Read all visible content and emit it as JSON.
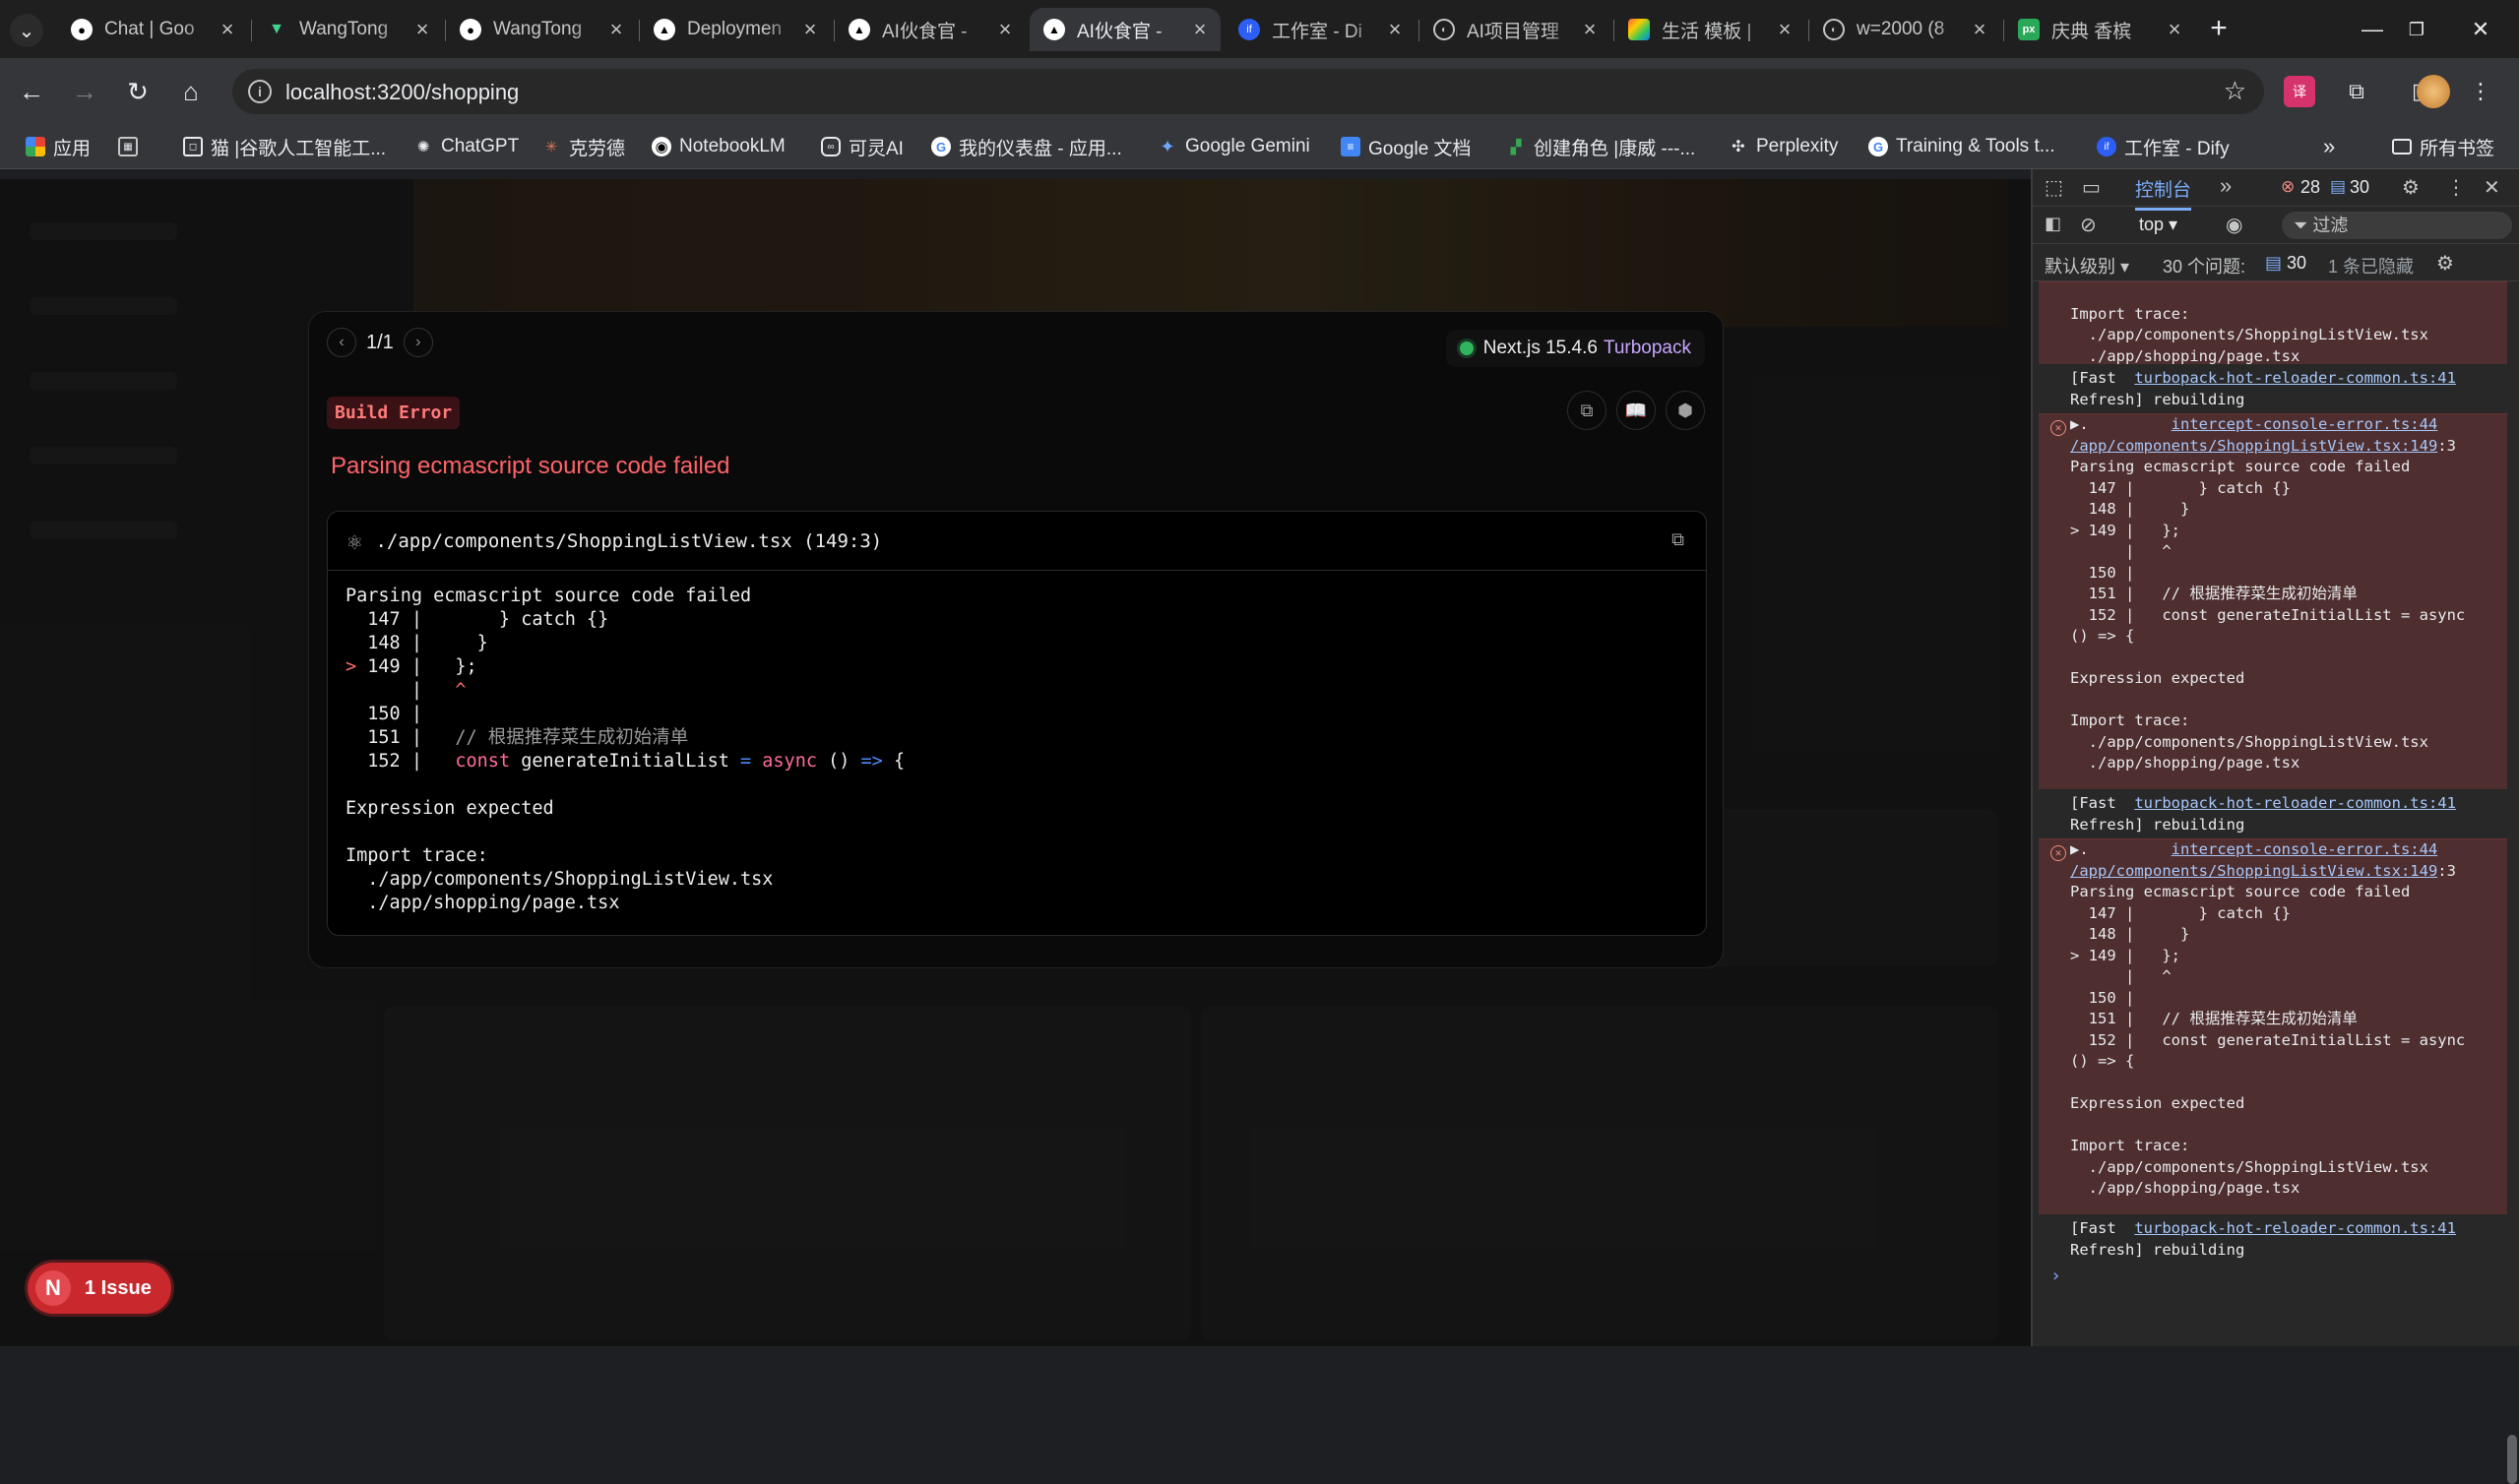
{
  "browser": {
    "tabs": [
      {
        "title": "Chat | Goo",
        "icon": "github-icon"
      },
      {
        "title": "WangTong",
        "icon": "vue-icon"
      },
      {
        "title": "WangTong",
        "icon": "github-icon"
      },
      {
        "title": "Deploymen",
        "icon": "vercel-icon"
      },
      {
        "title": "AI伙食官 - ",
        "icon": "vercel-icon"
      },
      {
        "title": "AI伙食官 - ",
        "icon": "vercel-icon",
        "active": true
      },
      {
        "title": "工作室 - Di",
        "icon": "dify-icon"
      },
      {
        "title": "AI项目管理",
        "icon": "globe-icon"
      },
      {
        "title": "生活 模板 |",
        "icon": "colorful-icon"
      },
      {
        "title": "w=2000 (8",
        "icon": "globe-icon"
      },
      {
        "title": "庆典 香槟",
        "icon": "px-icon"
      }
    ],
    "url": "localhost:3200/shopping",
    "bookmarks": [
      {
        "label": "应用",
        "icon": "apps-grid-icon"
      },
      {
        "label": "",
        "icon": "grid-icon"
      },
      {
        "label": "猫 |谷歌人工智能工...",
        "icon": "cat-icon"
      },
      {
        "label": "ChatGPT",
        "icon": "chatgpt-icon"
      },
      {
        "label": "克劳德",
        "icon": "claude-icon"
      },
      {
        "label": "NotebookLM",
        "icon": "notebooklm-icon"
      },
      {
        "label": "可灵AI",
        "icon": "kling-icon"
      },
      {
        "label": "我的仪表盘 - 应用...",
        "icon": "google-icon"
      },
      {
        "label": "Google Gemini",
        "icon": "gemini-icon"
      },
      {
        "label": "Google 文档",
        "icon": "docs-icon"
      },
      {
        "label": "创建角色 |康威 ---...",
        "icon": "conway-icon"
      },
      {
        "label": "Perplexity",
        "icon": "perplexity-icon"
      },
      {
        "label": "Training & Tools t...",
        "icon": "google-icon"
      },
      {
        "label": "工作室 - Dify",
        "icon": "dify-icon"
      }
    ],
    "all_bookmarks": "所有书签"
  },
  "overlay": {
    "pager": "1/1",
    "next_version": "Next.js 15.4.6",
    "bundler": "Turbopack",
    "badge": "Build Error",
    "title": "Parsing ecmascript source code failed",
    "file": "./app/components/ShoppingListView.tsx (149:3)",
    "code": {
      "heading": "Parsing ecmascript source code failed",
      "expected": "Expression expected",
      "import_trace_label": "Import trace:",
      "trace": [
        "./app/components/ShoppingListView.tsx",
        "./app/shopping/page.tsx"
      ]
    }
  },
  "issue_pill": {
    "letter": "N",
    "label": "1 Issue"
  },
  "devtools": {
    "console_tab": "控制台",
    "errors_count": "28",
    "messages_count": "30",
    "context": "top",
    "filter_placeholder": "过滤",
    "level": "默认级别",
    "issues": "30 个问题:",
    "issues_count": "30",
    "hidden": "1 条已隐藏",
    "reloader_link": "turbopack-hot-reloader-common.ts:41",
    "console_error_link": "intercept-console-error.ts:44",
    "source_link": "/app/components/ShoppingListView.tsx:149",
    "fast_refresh_a": "[Fast",
    "fast_refresh_b": "Refresh] rebuilding",
    "parse_failed": "Parsing ecmascript source code failed",
    "expression_expected": "Expression expected",
    "import_trace": "Import trace:",
    "trace_1": "./app/components/ShoppingListView.tsx",
    "trace_2": "./app/shopping/page.tsx"
  }
}
